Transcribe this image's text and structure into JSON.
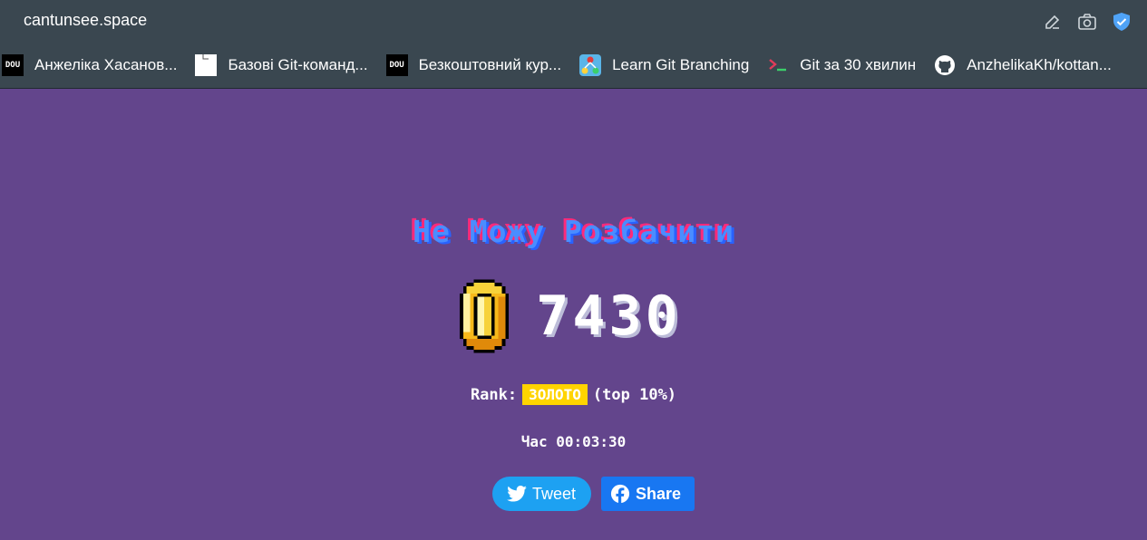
{
  "browser": {
    "url": "cantunsee.space",
    "bookmarks": [
      {
        "label": "Анжеліка Хасанов...",
        "icon": "dou-icon"
      },
      {
        "label": "Базові Git-команд...",
        "icon": "document-icon"
      },
      {
        "label": "Безкоштовний кур...",
        "icon": "dou-icon"
      },
      {
        "label": "Learn Git Branching",
        "icon": "git-branching-icon"
      },
      {
        "label": "Git за 30 хвилин",
        "icon": "terminal-icon"
      },
      {
        "label": "AnzhelikaKh/kottan...",
        "icon": "github-icon"
      }
    ],
    "dou_text": "DOU"
  },
  "game": {
    "title": "Не Можу Розбачити",
    "score": "7430",
    "rank_label": "Rank:",
    "rank_value": "ЗОЛОТО",
    "rank_suffix": "(top 10%)",
    "time_label": "Час",
    "time_value": "00:03:30",
    "tweet_label": "Tweet",
    "share_label": "Share"
  },
  "colors": {
    "background": "#63458c",
    "browser_bar": "#3a4750",
    "rank_badge": "#ffd400",
    "tweet": "#1da1f2",
    "share": "#1877f2"
  }
}
